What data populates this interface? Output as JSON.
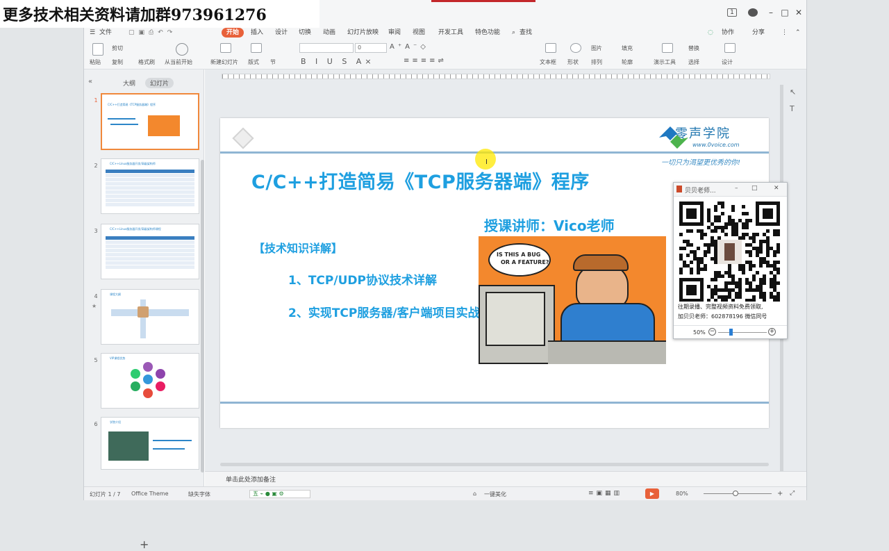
{
  "banner": {
    "text": "更多技术相关资料请加群973961276"
  },
  "window": {
    "controls": {
      "minimize": "–",
      "maximize": "□",
      "close": "✕"
    },
    "menu": [
      "文件",
      "开始",
      "插入",
      "设计",
      "切换",
      "动画",
      "幻灯片放映",
      "审阅",
      "视图",
      "开发工具",
      "特色功能",
      "查找"
    ],
    "menu_right": [
      "协作",
      "分享"
    ]
  },
  "ribbon": {
    "groups": [
      "粘贴",
      "剪切",
      "复制",
      "格式刷",
      "从当前开始",
      "新建幻灯片",
      "版式",
      "节",
      "文本框",
      "形状",
      "排列",
      "图片",
      "填充",
      "轮廓",
      "演示工具",
      "替换",
      "选择",
      "设计",
      "保存"
    ],
    "font_name": "",
    "font_size": "0"
  },
  "left_panel": {
    "tabs": {
      "outline": "大纲",
      "slides": "幻灯片"
    },
    "thumbs": [
      {
        "num": "1",
        "title": "C/C++打造简易《TCP服务器端》程序"
      },
      {
        "num": "2",
        "title": "C/C++Linux服务器开发/高级架构师"
      },
      {
        "num": "3",
        "title": "C/C++Linux服务器开发/高级架构师课程"
      },
      {
        "num": "4",
        "title": "课程大纲"
      },
      {
        "num": "5",
        "title": "VIP课程优势"
      },
      {
        "num": "6",
        "title": "学院介绍"
      }
    ],
    "add_slide": "+"
  },
  "slide": {
    "title": "C/C++打造简易《TCP服务器端》程序",
    "logo_name": "零声学院",
    "logo_url": "www.0voice.com",
    "slogan": "一切只为渴望更优秀的你!",
    "teacher": "授课讲师：Vico老师",
    "section": "【技术知识详解】",
    "bullets": [
      "1、TCP/UDP协议技术详解",
      "2、实现TCP服务器/客户端项目实战"
    ],
    "comic_bubble_line1": "IS THIS A BUG",
    "comic_bubble_line2": "OR A FEATURE?"
  },
  "notes": {
    "placeholder": "单击此处添加备注"
  },
  "status": {
    "slide_counter": "幻灯片 1 / 7",
    "theme": "Office Theme",
    "font_missing": "缺失字体",
    "beautify": "一键美化",
    "zoom": "80%"
  },
  "qr_popup": {
    "title": "贝贝老师...",
    "caption_line1": "往期录播、完整视频资料免费领取,",
    "caption_line2": "加贝贝老师：602878196 微信同号",
    "zoom": "50%"
  },
  "colors": {
    "accent": "#e8613a",
    "title_blue": "#1e9fe0",
    "slide_border": "#8fb5d3"
  }
}
